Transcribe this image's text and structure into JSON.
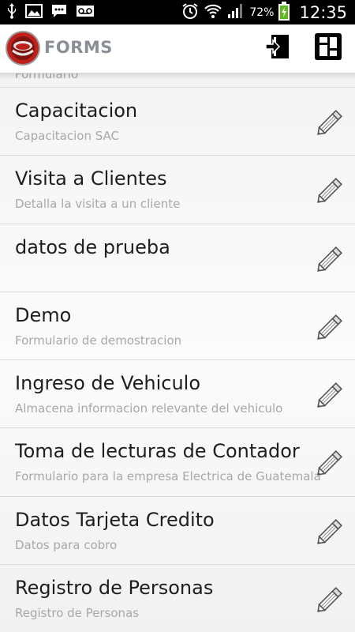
{
  "status_bar": {
    "battery_percent": "72%",
    "clock": "12:35",
    "icons": [
      "usb-icon",
      "image-icon",
      "chat-icon",
      "voicemail-icon",
      "alarm-icon",
      "wifi-icon",
      "signal-icon",
      "battery-charging-icon"
    ]
  },
  "action_bar": {
    "app_title": "FORMS",
    "buttons": [
      "login-icon",
      "dashboard-icon"
    ]
  },
  "list": {
    "partial_subtitle": "Formulario",
    "items": [
      {
        "title": "Capacitacion",
        "subtitle": "Capacitacion SAC"
      },
      {
        "title": "Visita a Clientes",
        "subtitle": "Detalla la visita a un cliente"
      },
      {
        "title": "datos de prueba",
        "subtitle": ""
      },
      {
        "title": "Demo",
        "subtitle": "Formulario de demostracion"
      },
      {
        "title": "Ingreso de Vehiculo",
        "subtitle": "Almacena informacion relevante del vehiculo"
      },
      {
        "title": "Toma de lecturas de Contador",
        "subtitle": "Formulario para la empresa Electrica de Guatemala"
      },
      {
        "title": "Datos Tarjeta Credito",
        "subtitle": "Datos para cobro"
      },
      {
        "title": "Registro de Personas",
        "subtitle": "Registro de Personas"
      }
    ]
  },
  "colors": {
    "status_bar": "#000000",
    "logo_red": "#c0201a",
    "title_gray": "#8a8f96",
    "item_title": "#1e1e1e",
    "item_subtitle": "#a8a8a8",
    "divider": "#dcdcdc"
  }
}
